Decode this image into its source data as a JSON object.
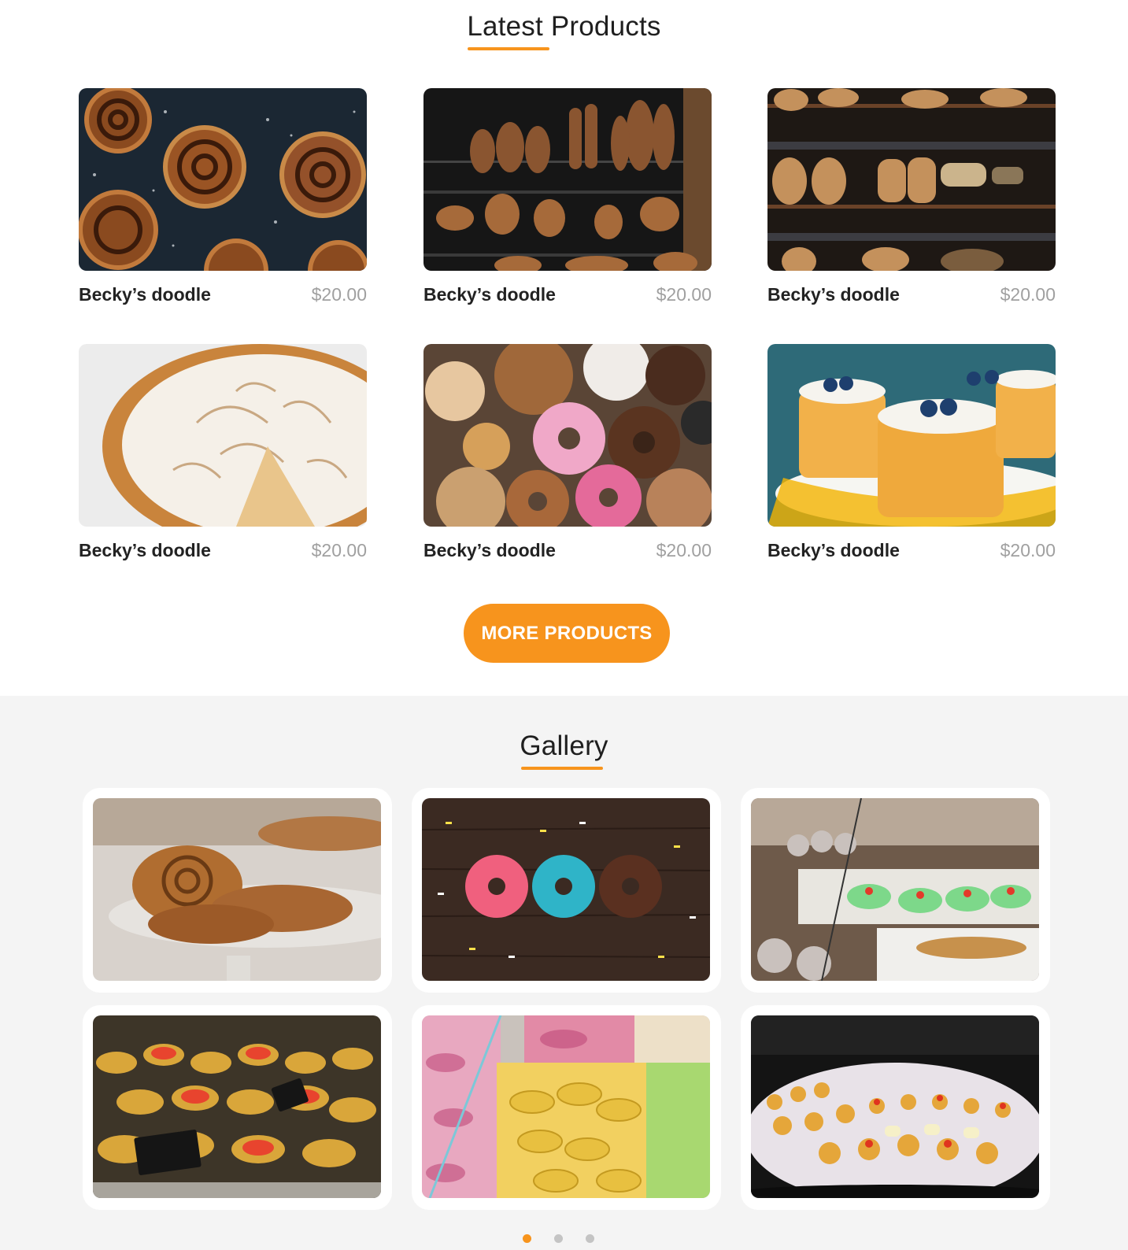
{
  "latest": {
    "title": "Latest Products",
    "products": [
      {
        "name": "Becky’s doodle",
        "price": "$20.00",
        "image": "cinnamon-rolls-photo"
      },
      {
        "name": "Becky’s doodle",
        "price": "$20.00",
        "image": "bread-shelves-photo"
      },
      {
        "name": "Becky’s doodle",
        "price": "$20.00",
        "image": "sourdough-rack-photo"
      },
      {
        "name": "Becky’s doodle",
        "price": "$20.00",
        "image": "meringue-pie-photo"
      },
      {
        "name": "Becky’s doodle",
        "price": "$20.00",
        "image": "donuts-assortment-photo"
      },
      {
        "name": "Becky’s doodle",
        "price": "$20.00",
        "image": "blueberry-cakes-photo"
      }
    ],
    "more_button": "MORE PRODUCTS"
  },
  "gallery": {
    "title": "Gallery",
    "images": [
      "pastries-display-photo",
      "sprinkle-donuts-photo",
      "cannoli-counter-photo",
      "tarts-display-photo",
      "macarons-photo",
      "pastry-case-photo"
    ],
    "pagination": {
      "pages": 3,
      "active": 1
    }
  },
  "colors": {
    "accent": "#f7941d",
    "price": "#a0a0a0",
    "gallery_bg": "#f4f4f4"
  }
}
